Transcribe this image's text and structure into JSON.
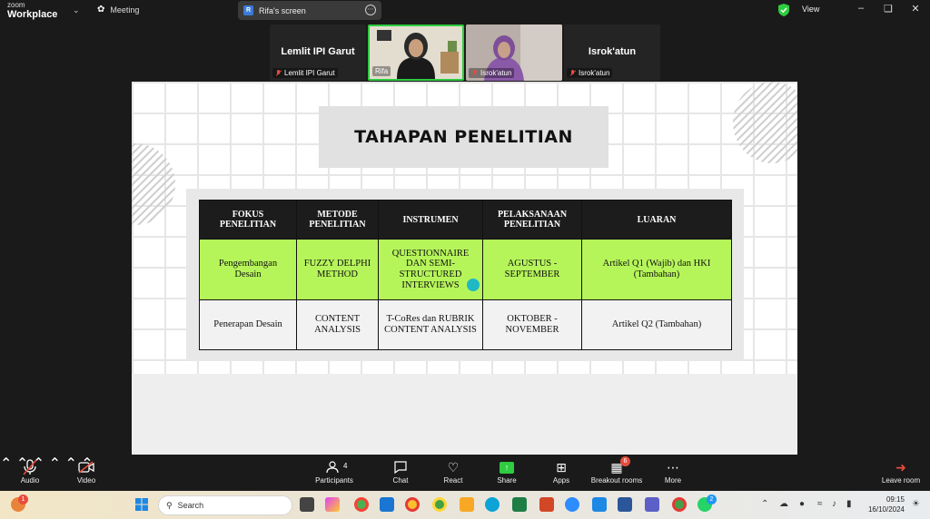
{
  "app": {
    "logo_line1": "zoom",
    "logo_line2": "Workplace",
    "meeting_label": "Meeting",
    "view_label": "View"
  },
  "screen_share": {
    "badge_letter": "R",
    "label": "Rifa's screen"
  },
  "participants": [
    {
      "display_name": "Lemlit IPI Garut",
      "caption": "Lemlit IPI Garut"
    },
    {
      "display_name": "",
      "caption": "Rifa"
    },
    {
      "display_name": "",
      "caption": "Isrok'atun"
    },
    {
      "display_name": "Isrok'atun",
      "caption": "Isrok'atun"
    }
  ],
  "slide": {
    "title": "TAHAPAN PENELITIAN",
    "headers": [
      "FOKUS PENELITIAN",
      "METODE PENELITIAN",
      "INSTRUMEN",
      "PELAKSANAAN PENELITIAN",
      "LUARAN"
    ],
    "rows": [
      [
        "Pengembangan Desain",
        "FUZZY DELPHI METHOD",
        "QUESTIONNAIRE DAN SEMI-STRUCTURED INTERVIEWS",
        "AGUSTUS - SEPTEMBER",
        "Artikel Q1 (Wajib) dan HKI (Tambahan)"
      ],
      [
        "Penerapan Desain",
        "CONTENT ANALYSIS",
        "T-CoRes dan RUBRIK CONTENT ANALYSIS",
        "OKTOBER - NOVEMBER",
        "Artikel Q2 (Tambahan)"
      ]
    ],
    "colors": {
      "highlight_row": "#b6f55a",
      "header_bg": "#1c1c1c",
      "cursor_dot": "#1fb8c4"
    }
  },
  "toolbar": {
    "audio": "Audio",
    "video": "Video",
    "participants": "Participants",
    "participants_count": "4",
    "chat": "Chat",
    "react": "React",
    "share": "Share",
    "apps": "Apps",
    "breakout": "Breakout rooms",
    "breakout_badge": "6",
    "more": "More",
    "leave": "Leave room"
  },
  "taskbar": {
    "search_placeholder": "Search",
    "time": "09:15",
    "date": "16/10/2024",
    "notif_badge": "1",
    "whatsapp_badge": "2"
  }
}
